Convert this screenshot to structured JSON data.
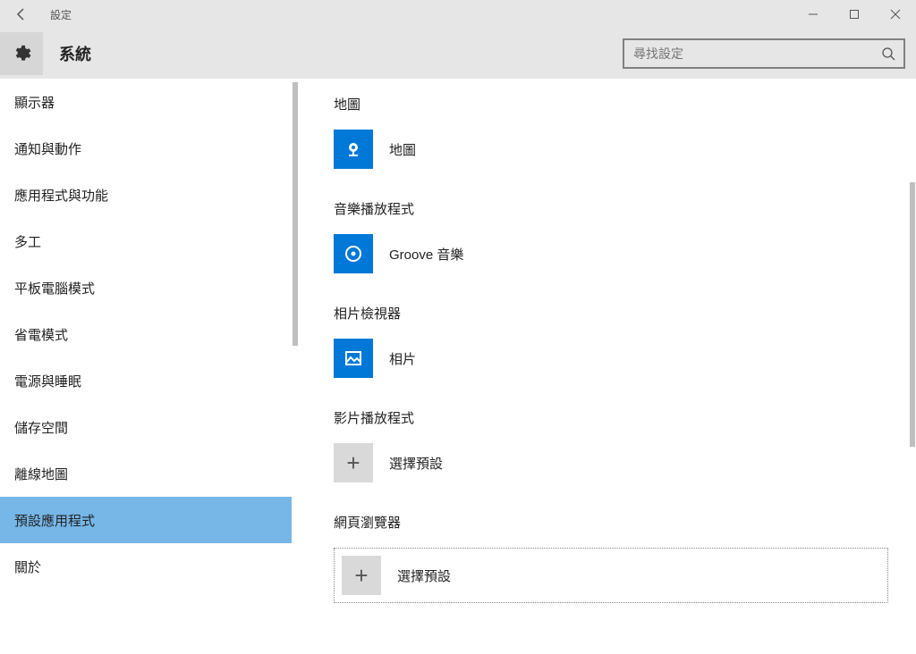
{
  "window": {
    "title": "設定"
  },
  "header": {
    "section": "系統",
    "search_placeholder": "尋找設定"
  },
  "sidebar": {
    "items": [
      {
        "label": "顯示器"
      },
      {
        "label": "通知與動作"
      },
      {
        "label": "應用程式與功能"
      },
      {
        "label": "多工"
      },
      {
        "label": "平板電腦模式"
      },
      {
        "label": "省電模式"
      },
      {
        "label": "電源與睡眠"
      },
      {
        "label": "儲存空間"
      },
      {
        "label": "離線地圖"
      },
      {
        "label": "預設應用程式"
      },
      {
        "label": "關於"
      }
    ],
    "selected_index": 9
  },
  "content": {
    "groups": [
      {
        "title": "地圖",
        "app": "地圖",
        "icon": "maps"
      },
      {
        "title": "音樂播放程式",
        "app": "Groove 音樂",
        "icon": "groove"
      },
      {
        "title": "相片檢視器",
        "app": "相片",
        "icon": "photos"
      },
      {
        "title": "影片播放程式",
        "app": "選擇預設",
        "icon": "plus"
      },
      {
        "title": "網頁瀏覽器",
        "app": "選擇預設",
        "icon": "plus",
        "highlighted": true
      }
    ]
  }
}
